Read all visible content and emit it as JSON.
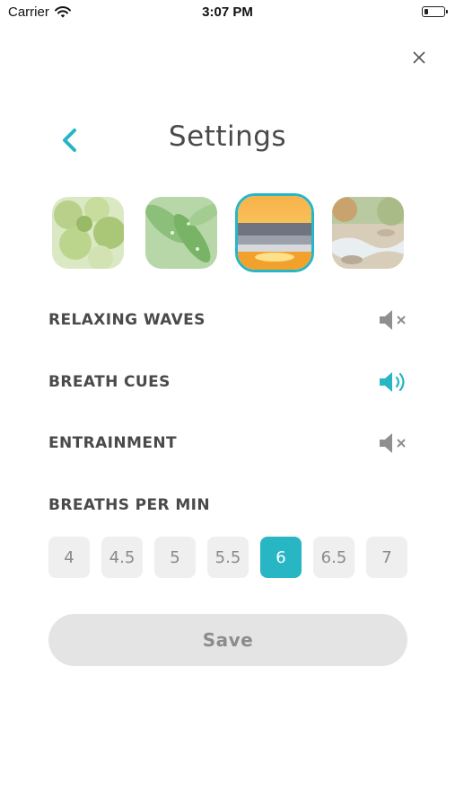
{
  "status_bar": {
    "carrier": "Carrier",
    "time": "3:07 PM",
    "battery_level": 0.2
  },
  "header": {
    "title": "Settings",
    "back_icon": "chevron-left-icon",
    "close_label": "X"
  },
  "scenes": [
    {
      "name": "green-leaves",
      "selected": false
    },
    {
      "name": "rain-leaves",
      "selected": false
    },
    {
      "name": "ocean-sunset",
      "selected": true
    },
    {
      "name": "river-stream",
      "selected": false
    }
  ],
  "sound_options": [
    {
      "label": "RELAXING WAVES",
      "icon": "speaker-muted-icon",
      "on": false
    },
    {
      "label": "BREATH CUES",
      "icon": "speaker-on-icon",
      "on": true
    },
    {
      "label": "ENTRAINMENT",
      "icon": "speaker-muted-icon",
      "on": false
    }
  ],
  "breaths": {
    "label": "BREATHS PER MIN",
    "options": [
      "4",
      "4.5",
      "5",
      "5.5",
      "6",
      "6.5",
      "7"
    ],
    "selected": "6"
  },
  "save_label": "Save",
  "colors": {
    "accent": "#28b6c4",
    "text": "#4a4a4a",
    "muted": "#8a8a8a",
    "chip_bg": "#efefef",
    "save_bg": "#e4e4e4"
  }
}
